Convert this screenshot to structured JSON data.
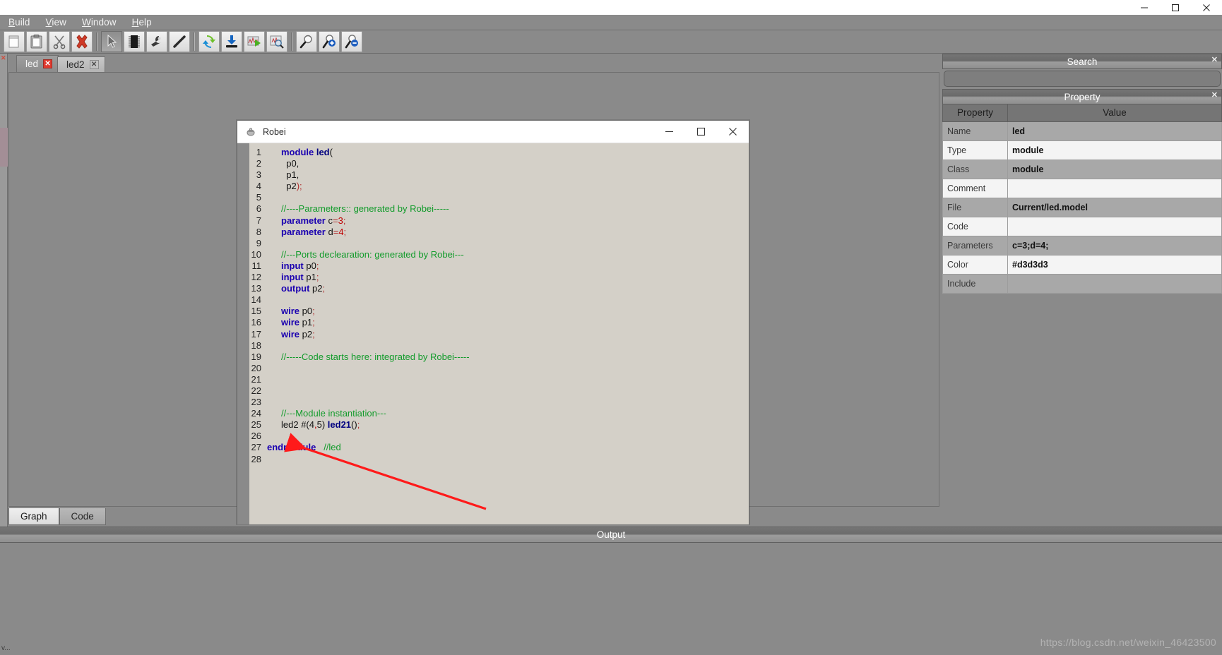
{
  "window": {
    "minimize": "–",
    "maximize": "☐",
    "close": "✕"
  },
  "menubar": {
    "items": [
      {
        "label": "Build",
        "mnemonic": "B"
      },
      {
        "label": "View",
        "mnemonic": "V"
      },
      {
        "label": "Window",
        "mnemonic": "W"
      },
      {
        "label": "Help",
        "mnemonic": "H"
      }
    ]
  },
  "toolbar": {
    "groups": [
      {
        "buttons": [
          {
            "name": "new-icon",
            "title": "New"
          },
          {
            "name": "paste-icon",
            "title": "Paste"
          },
          {
            "name": "cut-scissors-icon",
            "title": "Cut"
          },
          {
            "name": "delete-x-icon",
            "title": "Delete"
          }
        ]
      },
      {
        "buttons": [
          {
            "name": "select-cursor-icon",
            "title": "Select",
            "pressed": true
          },
          {
            "name": "chip-module-icon",
            "title": "Module"
          },
          {
            "name": "port-plug-icon",
            "title": "Port"
          },
          {
            "name": "wire-line-icon",
            "title": "Wire"
          }
        ]
      },
      {
        "buttons": [
          {
            "name": "compile-refresh-icon",
            "title": "Compile"
          },
          {
            "name": "download-icon",
            "title": "Download"
          },
          {
            "name": "run-simulate-icon",
            "title": "Run"
          },
          {
            "name": "waveform-inspect-icon",
            "title": "Inspect"
          }
        ]
      },
      {
        "buttons": [
          {
            "name": "zoom-out-icon",
            "title": "Zoom Out"
          },
          {
            "name": "zoom-in-icon",
            "title": "Zoom In"
          },
          {
            "name": "zoom-fit-icon",
            "title": "Zoom Fit"
          }
        ]
      }
    ]
  },
  "document_tabs": [
    {
      "label": "led",
      "active": true,
      "close": "✕"
    },
    {
      "label": "led2",
      "active": false,
      "close": "✕"
    }
  ],
  "view_tabs": [
    {
      "label": "Graph",
      "active": true
    },
    {
      "label": "Code",
      "active": false
    }
  ],
  "left_strip": {
    "corner_mark": "✕",
    "bottom_label": "v..."
  },
  "search_panel": {
    "title": "Search",
    "close": "✕",
    "input_value": "",
    "placeholder": ""
  },
  "property_panel": {
    "title": "Property",
    "close": "✕",
    "columns": [
      "Property",
      "Value"
    ],
    "rows": [
      {
        "key": "Name",
        "value": "led"
      },
      {
        "key": "Type",
        "value": "module"
      },
      {
        "key": "Class",
        "value": "module"
      },
      {
        "key": "Comment",
        "value": ""
      },
      {
        "key": "File",
        "value": "Current/led.model"
      },
      {
        "key": "Code",
        "value": ""
      },
      {
        "key": "Parameters",
        "value": "c=3;d=4;"
      },
      {
        "key": "Color",
        "value": "#d3d3d3"
      },
      {
        "key": "Include",
        "value": ""
      }
    ]
  },
  "output_panel": {
    "title": "Output",
    "content": ""
  },
  "statusbar": {
    "left_text": "v...",
    "watermark": "https://blog.csdn.net/weixin_46423500"
  },
  "dialog": {
    "title": "Robei",
    "icon": "robei-logo-icon",
    "minimize": "–",
    "maximize": "☐",
    "close": "✕",
    "code_lines": [
      {
        "n": "1",
        "tokens": [
          {
            "t": "module ",
            "c": "kw"
          },
          {
            "t": "led",
            "c": "mod"
          },
          {
            "t": "(",
            "c": "pln"
          }
        ],
        "indent": 0
      },
      {
        "n": "2",
        "tokens": [
          {
            "t": "  p0,",
            "c": "pln"
          }
        ],
        "indent": 0
      },
      {
        "n": "3",
        "tokens": [
          {
            "t": "  p1,",
            "c": "pln"
          }
        ],
        "indent": 0
      },
      {
        "n": "4",
        "tokens": [
          {
            "t": "  p2",
            "c": "pln"
          },
          {
            "t": ");",
            "c": "pun"
          }
        ],
        "indent": 0
      },
      {
        "n": "5",
        "tokens": [],
        "indent": 0
      },
      {
        "n": "6",
        "tokens": [
          {
            "t": "//----Parameters:: generated by Robei-----",
            "c": "cmt"
          }
        ],
        "indent": 0
      },
      {
        "n": "7",
        "tokens": [
          {
            "t": "parameter ",
            "c": "kw"
          },
          {
            "t": "c",
            "c": "pln"
          },
          {
            "t": "=",
            "c": "pun"
          },
          {
            "t": "3",
            "c": "num"
          },
          {
            "t": ";",
            "c": "pun"
          }
        ],
        "indent": 0
      },
      {
        "n": "8",
        "tokens": [
          {
            "t": "parameter ",
            "c": "kw"
          },
          {
            "t": "d",
            "c": "pln"
          },
          {
            "t": "=",
            "c": "pun"
          },
          {
            "t": "4",
            "c": "num"
          },
          {
            "t": ";",
            "c": "pun"
          }
        ],
        "indent": 0
      },
      {
        "n": "9",
        "tokens": [],
        "indent": 0
      },
      {
        "n": "10",
        "tokens": [
          {
            "t": "//---Ports declearation: generated by Robei---",
            "c": "cmt"
          }
        ],
        "indent": 0
      },
      {
        "n": "11",
        "tokens": [
          {
            "t": "input ",
            "c": "kw"
          },
          {
            "t": "p0",
            "c": "pln"
          },
          {
            "t": ";",
            "c": "pun"
          }
        ],
        "indent": 0
      },
      {
        "n": "12",
        "tokens": [
          {
            "t": "input ",
            "c": "kw"
          },
          {
            "t": "p1",
            "c": "pln"
          },
          {
            "t": ";",
            "c": "pun"
          }
        ],
        "indent": 0
      },
      {
        "n": "13",
        "tokens": [
          {
            "t": "output ",
            "c": "kw"
          },
          {
            "t": "p2",
            "c": "pln"
          },
          {
            "t": ";",
            "c": "pun"
          }
        ],
        "indent": 0
      },
      {
        "n": "14",
        "tokens": [],
        "indent": 0
      },
      {
        "n": "15",
        "tokens": [
          {
            "t": "wire ",
            "c": "kw"
          },
          {
            "t": "p0",
            "c": "pln"
          },
          {
            "t": ";",
            "c": "pun"
          }
        ],
        "indent": 0
      },
      {
        "n": "16",
        "tokens": [
          {
            "t": "wire ",
            "c": "kw"
          },
          {
            "t": "p1",
            "c": "pln"
          },
          {
            "t": ";",
            "c": "pun"
          }
        ],
        "indent": 0
      },
      {
        "n": "17",
        "tokens": [
          {
            "t": "wire ",
            "c": "kw"
          },
          {
            "t": "p2",
            "c": "pln"
          },
          {
            "t": ";",
            "c": "pun"
          }
        ],
        "indent": 0
      },
      {
        "n": "18",
        "tokens": [],
        "indent": 0
      },
      {
        "n": "19",
        "tokens": [
          {
            "t": "//-----Code starts here: integrated by Robei-----",
            "c": "cmt"
          }
        ],
        "indent": 0
      },
      {
        "n": "20",
        "tokens": [],
        "indent": 0
      },
      {
        "n": "21",
        "tokens": [],
        "indent": 0
      },
      {
        "n": "22",
        "tokens": [],
        "indent": 0
      },
      {
        "n": "23",
        "tokens": [],
        "indent": 0
      },
      {
        "n": "24",
        "tokens": [
          {
            "t": "//---Module instantiation---",
            "c": "cmt"
          }
        ],
        "indent": 0
      },
      {
        "n": "25",
        "tokens": [
          {
            "t": "led2 #(4",
            "c": "pln"
          },
          {
            "t": ",",
            "c": "num"
          },
          {
            "t": "5) ",
            "c": "pln"
          },
          {
            "t": "led21",
            "c": "mod"
          },
          {
            "t": "()",
            "c": "pln"
          },
          {
            "t": ";",
            "c": "pun"
          }
        ],
        "indent": 0
      },
      {
        "n": "26",
        "tokens": [],
        "indent": 0
      },
      {
        "n": "27",
        "tokens": [
          {
            "t": "endmodule",
            "c": "kw"
          },
          {
            "t": "   ",
            "c": "pln"
          },
          {
            "t": "//led",
            "c": "cmt"
          }
        ],
        "indent": -1
      },
      {
        "n": "28",
        "tokens": [],
        "indent": 0
      }
    ]
  },
  "annotation": {
    "arrow_color": "#ff1a1a",
    "name": "red-pointer-arrow"
  }
}
